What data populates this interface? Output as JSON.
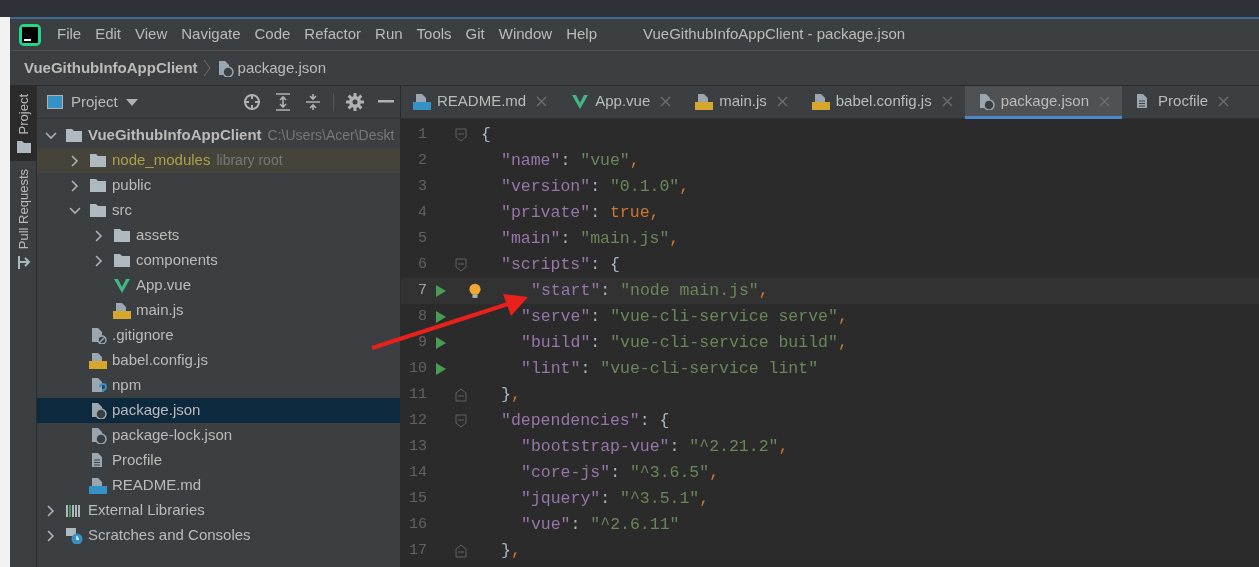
{
  "menu": [
    "File",
    "Edit",
    "View",
    "Navigate",
    "Code",
    "Refactor",
    "Run",
    "Tools",
    "Git",
    "Window",
    "Help"
  ],
  "window": {
    "title": "VueGithubInfoAppClient - package.json"
  },
  "breadcrumb": [
    {
      "label": "VueGithubInfoAppClient"
    },
    {
      "label": "package.json",
      "kind": "json"
    }
  ],
  "tool_strip": [
    {
      "label": "Project",
      "selected": true
    },
    {
      "label": "Pull Requests",
      "selected": false
    }
  ],
  "project_panel": {
    "title": "Project"
  },
  "tree": [
    {
      "label": "VueGithubInfoAppClient",
      "hint": "C:\\Users\\Acer\\Deskt",
      "kind": "folder",
      "expanded": true,
      "selected": false,
      "children": [
        {
          "label": "node_modules",
          "hint": "library root",
          "kind": "library-folder",
          "expanded": false,
          "selected": false
        },
        {
          "label": "public",
          "kind": "folder",
          "expanded": false,
          "selected": false
        },
        {
          "label": "src",
          "kind": "folder",
          "expanded": true,
          "selected": false,
          "children": [
            {
              "label": "assets",
              "kind": "folder",
              "expanded": false,
              "selected": false
            },
            {
              "label": "components",
              "kind": "folder",
              "expanded": false,
              "selected": false
            },
            {
              "label": "App.vue",
              "kind": "vue",
              "selected": false
            },
            {
              "label": "main.js",
              "kind": "js",
              "selected": false
            }
          ]
        },
        {
          "label": ".gitignore",
          "kind": "ignore",
          "selected": false
        },
        {
          "label": "babel.config.js",
          "kind": "js",
          "selected": false
        },
        {
          "label": "npm",
          "kind": "unknown",
          "selected": false
        },
        {
          "label": "package.json",
          "kind": "json",
          "selected": true
        },
        {
          "label": "package-lock.json",
          "kind": "json",
          "selected": false
        },
        {
          "label": "Procfile",
          "kind": "text",
          "selected": false
        },
        {
          "label": "README.md",
          "kind": "md",
          "selected": false
        }
      ]
    },
    {
      "label": "External Libraries",
      "kind": "libraries",
      "expanded": false,
      "selected": false
    },
    {
      "label": "Scratches and Consoles",
      "kind": "scratches",
      "expanded": false,
      "selected": false
    }
  ],
  "tabs": [
    {
      "label": "README.md",
      "kind": "md",
      "selected": false
    },
    {
      "label": "App.vue",
      "kind": "vue",
      "selected": false
    },
    {
      "label": "main.js",
      "kind": "js",
      "selected": false
    },
    {
      "label": "babel.config.js",
      "kind": "js",
      "selected": false
    },
    {
      "label": "package.json",
      "kind": "json",
      "selected": true
    },
    {
      "label": "Procfile",
      "kind": "text",
      "selected": false
    }
  ],
  "editor": {
    "lines": [
      {
        "number": "1",
        "run": false,
        "current": false,
        "tokens": [
          {
            "kind": "punct",
            "text": "{"
          }
        ]
      },
      {
        "number": "2",
        "run": false,
        "current": false,
        "tokens": [
          {
            "kind": "key",
            "text": "\"name\""
          },
          {
            "kind": "punct",
            "text": ": "
          },
          {
            "kind": "string",
            "text": "\"vue\""
          },
          {
            "kind": "comma",
            "text": ","
          }
        ]
      },
      {
        "number": "3",
        "run": false,
        "current": false,
        "tokens": [
          {
            "kind": "key",
            "text": "\"version\""
          },
          {
            "kind": "punct",
            "text": ": "
          },
          {
            "kind": "string",
            "text": "\"0.1.0\""
          },
          {
            "kind": "comma",
            "text": ","
          }
        ]
      },
      {
        "number": "4",
        "run": false,
        "current": false,
        "tokens": [
          {
            "kind": "key",
            "text": "\"private\""
          },
          {
            "kind": "punct",
            "text": ": "
          },
          {
            "kind": "keyword",
            "text": "true"
          },
          {
            "kind": "comma",
            "text": ","
          }
        ]
      },
      {
        "number": "5",
        "run": false,
        "current": false,
        "tokens": [
          {
            "kind": "key",
            "text": "\"main\""
          },
          {
            "kind": "punct",
            "text": ": "
          },
          {
            "kind": "string",
            "text": "\"main.js\""
          },
          {
            "kind": "comma",
            "text": ","
          }
        ]
      },
      {
        "number": "6",
        "run": false,
        "current": false,
        "tokens": [
          {
            "kind": "key",
            "text": "\"scripts\""
          },
          {
            "kind": "punct",
            "text": ": {"
          }
        ]
      },
      {
        "number": "7",
        "run": true,
        "current": true,
        "tokens": [
          {
            "kind": "key",
            "text": "\"start\""
          },
          {
            "kind": "punct",
            "text": ": "
          },
          {
            "kind": "string",
            "text": "\"node main.js\""
          },
          {
            "kind": "comma",
            "text": ","
          }
        ]
      },
      {
        "number": "8",
        "run": true,
        "current": false,
        "tokens": [
          {
            "kind": "key",
            "text": "\"serve\""
          },
          {
            "kind": "punct",
            "text": ": "
          },
          {
            "kind": "string",
            "text": "\"vue-cli-service serve\""
          },
          {
            "kind": "comma",
            "text": ","
          }
        ]
      },
      {
        "number": "9",
        "run": true,
        "current": false,
        "tokens": [
          {
            "kind": "key",
            "text": "\"build\""
          },
          {
            "kind": "punct",
            "text": ": "
          },
          {
            "kind": "string",
            "text": "\"vue-cli-service build\""
          },
          {
            "kind": "comma",
            "text": ","
          }
        ]
      },
      {
        "number": "10",
        "run": true,
        "current": false,
        "tokens": [
          {
            "kind": "key",
            "text": "\"lint\""
          },
          {
            "kind": "punct",
            "text": ": "
          },
          {
            "kind": "string",
            "text": "\"vue-cli-service lint\""
          }
        ]
      },
      {
        "number": "11",
        "run": false,
        "current": false,
        "tokens": [
          {
            "kind": "punct",
            "text": "}"
          },
          {
            "kind": "comma",
            "text": ","
          }
        ]
      },
      {
        "number": "12",
        "run": false,
        "current": false,
        "tokens": [
          {
            "kind": "key",
            "text": "\"dependencies\""
          },
          {
            "kind": "punct",
            "text": ": {"
          }
        ]
      },
      {
        "number": "13",
        "run": false,
        "current": false,
        "tokens": [
          {
            "kind": "key",
            "text": "\"bootstrap-vue\""
          },
          {
            "kind": "punct",
            "text": ": "
          },
          {
            "kind": "string",
            "text": "\"^2.21.2\""
          },
          {
            "kind": "comma",
            "text": ","
          }
        ]
      },
      {
        "number": "14",
        "run": false,
        "current": false,
        "tokens": [
          {
            "kind": "key",
            "text": "\"core-js\""
          },
          {
            "kind": "punct",
            "text": ": "
          },
          {
            "kind": "string",
            "text": "\"^3.6.5\""
          },
          {
            "kind": "comma",
            "text": ","
          }
        ]
      },
      {
        "number": "15",
        "run": false,
        "current": false,
        "tokens": [
          {
            "kind": "key",
            "text": "\"jquery\""
          },
          {
            "kind": "punct",
            "text": ": "
          },
          {
            "kind": "string",
            "text": "\"^3.5.1\""
          },
          {
            "kind": "comma",
            "text": ","
          }
        ]
      },
      {
        "number": "16",
        "run": false,
        "current": false,
        "tokens": [
          {
            "kind": "key",
            "text": "\"vue\""
          },
          {
            "kind": "punct",
            "text": ": "
          },
          {
            "kind": "string",
            "text": "\"^2.6.11\""
          }
        ]
      },
      {
        "number": "17",
        "run": false,
        "current": false,
        "tokens": [
          {
            "kind": "punct",
            "text": "}"
          },
          {
            "kind": "comma",
            "text": ","
          }
        ]
      }
    ]
  }
}
